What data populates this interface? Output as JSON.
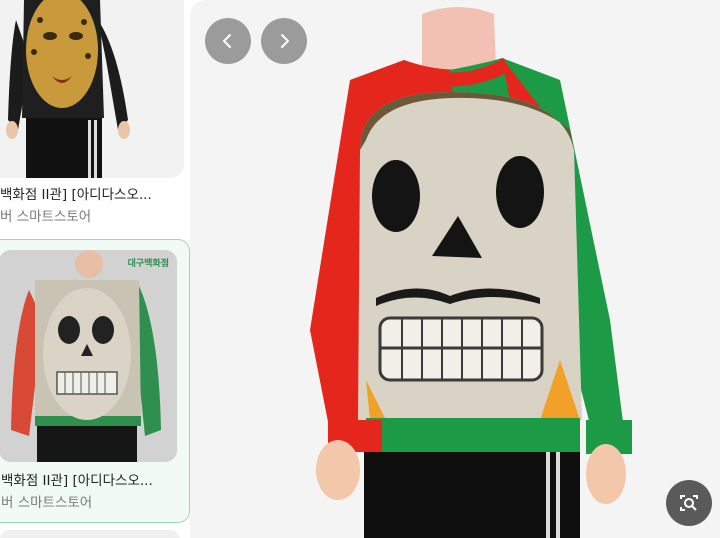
{
  "results": [
    {
      "title": "백화점 II관] [아디다스오...",
      "source": "버 스마트스토어"
    },
    {
      "title": "백화점 II관] [아디다스오...",
      "source": "버 스마트스토어",
      "watermark": "대구백화점"
    }
  ],
  "viewer": {
    "prev_icon": "chevron-left-icon",
    "next_icon": "chevron-right-icon",
    "lens_icon": "lens-search-icon"
  },
  "colors": {
    "accent_border": "#9fd6b6",
    "sweater_red": "#e8352a",
    "sweater_green": "#1f9a45"
  }
}
